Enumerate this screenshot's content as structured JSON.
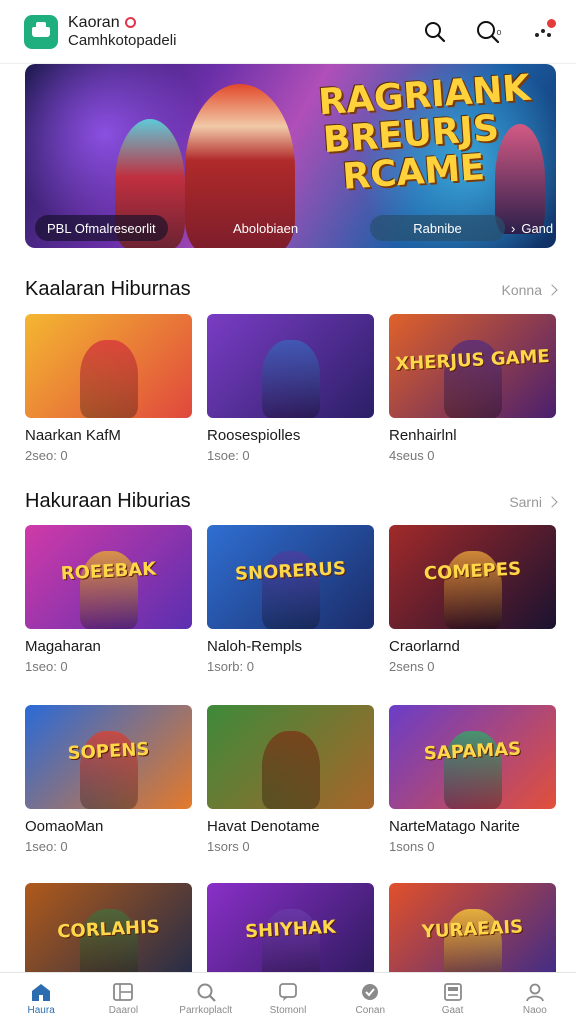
{
  "header": {
    "brand_line1": "Kaoran",
    "brand_line2": "Camhkotopadeli",
    "search_mini": "o"
  },
  "banner": {
    "title": "RAGRIANK\nBREURJS\nRCAME",
    "chip1": "PBL Ofmalreseorlit",
    "chip2": "Abolobiaen",
    "chip3": "Rabnibe",
    "chip4": "Gand"
  },
  "sections": [
    {
      "title": "Kaalaran Hiburnas",
      "more": "Konna",
      "items": [
        {
          "name": "Naarkan KafM",
          "meta": "2seo: 0",
          "tag": "",
          "bg": "#f4b731",
          "bg2": "#e0483d",
          "fig": "#d93b3b"
        },
        {
          "name": "Roosespiolles",
          "meta": "1soe: 0",
          "tag": "",
          "bg": "#7a3cc4",
          "bg2": "#2b1f66",
          "fig": "#3d5fb8"
        },
        {
          "name": "Renhairlnl",
          "meta": "4seus 0",
          "tag": "XHERJUS GAME",
          "bg": "#e0622a",
          "bg2": "#4a1f6e",
          "fig": "#5a2f7a"
        }
      ]
    },
    {
      "title": "Hakuraan Hiburias",
      "more": "Sarni",
      "items": [
        {
          "name": "Magaharan",
          "meta": "1seo: 0",
          "tag": "ROEEBAK",
          "bg": "#d03aa8",
          "bg2": "#5a2fb0",
          "fig": "#e2a23a"
        },
        {
          "name": "Naloh-Rempls",
          "meta": "1sorb: 0",
          "tag": "SNORERUS",
          "bg": "#2f6fd1",
          "bg2": "#1b2c6a",
          "fig": "#4a3fa0"
        },
        {
          "name": "Craorlarnd",
          "meta": "2sens 0",
          "tag": "COMEPES",
          "bg": "#a12a2a",
          "bg2": "#1a1230",
          "fig": "#e09a3a"
        }
      ]
    },
    {
      "title": "",
      "more": "",
      "items": [
        {
          "name": "OomaoMan",
          "meta": "1seo: 0",
          "tag": "SOPENS",
          "bg": "#2a6ad8",
          "bg2": "#e47a2a",
          "fig": "#d2453a"
        },
        {
          "name": "Havat Denotame",
          "meta": "1sors 0",
          "tag": "",
          "bg": "#3d8a3a",
          "bg2": "#a8652a",
          "fig": "#7a3b1a"
        },
        {
          "name": "NarteMatago Narite",
          "meta": "1sons 0",
          "tag": "SAPAMAS",
          "bg": "#6a3dc8",
          "bg2": "#e2503a",
          "fig": "#3aa06a"
        }
      ]
    },
    {
      "title": "",
      "more": "",
      "items": [
        {
          "name": "",
          "meta": "",
          "tag": "CORLAHIS",
          "bg": "#b05a1a",
          "bg2": "#1f2a4a",
          "fig": "#4a6a3a"
        },
        {
          "name": "",
          "meta": "",
          "tag": "SHIYHAK",
          "bg": "#8a2fc8",
          "bg2": "#2a1a5a",
          "fig": "#6a3aa8"
        },
        {
          "name": "",
          "meta": "",
          "tag": "YURAEAIS",
          "bg": "#e2502a",
          "bg2": "#3a2a8a",
          "fig": "#f2c23a"
        }
      ]
    }
  ],
  "bottom_nav": [
    {
      "label": "Haura",
      "icon": "home-icon",
      "active": true
    },
    {
      "label": "Daarol",
      "icon": "grid-icon",
      "active": false
    },
    {
      "label": "Parrkoplaclt",
      "icon": "search-icon",
      "active": false
    },
    {
      "label": "Stomonl",
      "icon": "chat-icon",
      "active": false
    },
    {
      "label": "Conan",
      "icon": "check-icon",
      "active": false
    },
    {
      "label": "Gaat",
      "icon": "card-icon",
      "active": false
    },
    {
      "label": "Naoo",
      "icon": "profile-icon",
      "active": false
    }
  ],
  "colors": {
    "accent": "#2c6db0",
    "logo": "#1fae7e",
    "badge": "#e43b3b"
  }
}
